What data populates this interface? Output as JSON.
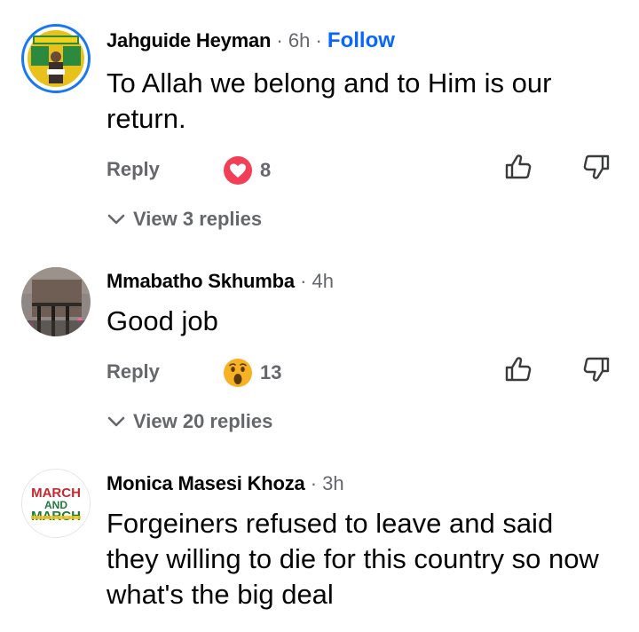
{
  "comments": [
    {
      "author": "Jahguide Heyman",
      "time": "6h",
      "follow_label": "Follow",
      "text": "To Allah we belong and to Him is our return.",
      "reply_label": "Reply",
      "reaction": "love-icon",
      "reaction_count": "8",
      "view_replies": "View 3 replies",
      "avatar_ring": "#1877f2"
    },
    {
      "author": "Mmabatho Skhumba",
      "time": "4h",
      "text": "Good job",
      "reply_label": "Reply",
      "reaction": "wow-icon",
      "reaction_count": "13",
      "view_replies": "View 20 replies"
    },
    {
      "author": "Monica Masesi Khoza",
      "time": "3h",
      "text": "Forgeiners refused to leave and said they willing to die for this country so now what's the big deal",
      "avatar_logo": "MARCH AND MARCH"
    }
  ],
  "separator": "·",
  "colors": {
    "accent": "#0866ff",
    "secondary_text": "#65676b",
    "love": "#f33e58",
    "wow": "#f7b125"
  }
}
